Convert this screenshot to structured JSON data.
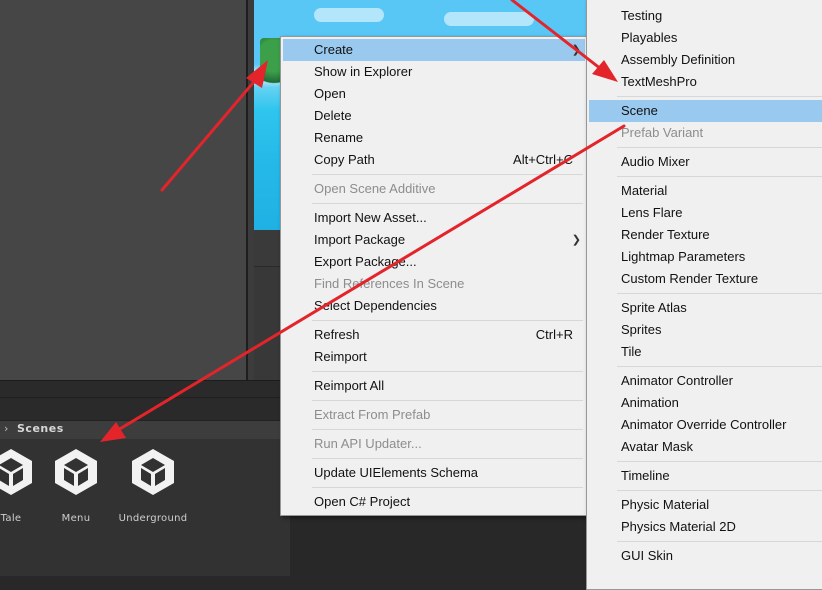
{
  "project": {
    "breadcrumb": "Scenes",
    "assets": [
      {
        "label": "Tale"
      },
      {
        "label": "Menu"
      },
      {
        "label": "Underground"
      }
    ]
  },
  "context_menu": {
    "items": [
      {
        "label": "Create",
        "shortcut": "",
        "submenu": true,
        "highlighted": true
      },
      {
        "label": "Show in Explorer",
        "shortcut": ""
      },
      {
        "label": "Open",
        "shortcut": ""
      },
      {
        "label": "Delete",
        "shortcut": ""
      },
      {
        "label": "Rename",
        "shortcut": ""
      },
      {
        "label": "Copy Path",
        "shortcut": "Alt+Ctrl+C"
      },
      {
        "label": "Open Scene Additive",
        "shortcut": "",
        "disabled": true
      },
      {
        "label": "Import New Asset...",
        "shortcut": ""
      },
      {
        "label": "Import Package",
        "shortcut": "",
        "submenu": true
      },
      {
        "label": "Export Package...",
        "shortcut": ""
      },
      {
        "label": "Find References In Scene",
        "shortcut": "",
        "disabled": true
      },
      {
        "label": "Select Dependencies",
        "shortcut": ""
      },
      {
        "label": "Refresh",
        "shortcut": "Ctrl+R"
      },
      {
        "label": "Reimport",
        "shortcut": ""
      },
      {
        "label": "Reimport All",
        "shortcut": ""
      },
      {
        "label": "Extract From Prefab",
        "shortcut": "",
        "disabled": true
      },
      {
        "label": "Run API Updater...",
        "shortcut": "",
        "disabled": true
      },
      {
        "label": "Update UIElements Schema",
        "shortcut": ""
      },
      {
        "label": "Open C# Project",
        "shortcut": ""
      }
    ]
  },
  "create_submenu": {
    "items": [
      {
        "label": "Testing",
        "submenu": true
      },
      {
        "label": "Playables",
        "submenu": true
      },
      {
        "label": "Assembly Definition"
      },
      {
        "label": "TextMeshPro",
        "submenu": true
      },
      {
        "label": "Scene",
        "highlighted": true
      },
      {
        "label": "Prefab Variant",
        "disabled": true
      },
      {
        "label": "Audio Mixer"
      },
      {
        "label": "Material"
      },
      {
        "label": "Lens Flare"
      },
      {
        "label": "Render Texture"
      },
      {
        "label": "Lightmap Parameters"
      },
      {
        "label": "Custom Render Texture"
      },
      {
        "label": "Sprite Atlas"
      },
      {
        "label": "Sprites",
        "submenu": true
      },
      {
        "label": "Tile"
      },
      {
        "label": "Animator Controller"
      },
      {
        "label": "Animation"
      },
      {
        "label": "Animator Override Controller"
      },
      {
        "label": "Avatar Mask"
      },
      {
        "label": "Timeline"
      },
      {
        "label": "Physic Material"
      },
      {
        "label": "Physics Material 2D"
      },
      {
        "label": "GUI Skin"
      }
    ]
  },
  "colors": {
    "menu_highlight": "#99c9ef",
    "menu_background": "#f0f0f0",
    "annotation_arrow": "#e3242b",
    "editor_dark": "#282828"
  },
  "icons": {
    "submenu_arrow": "chevron-right-icon",
    "asset_icon": "unity-logo-icon",
    "breadcrumb_arrow": "chevron-right-icon"
  }
}
